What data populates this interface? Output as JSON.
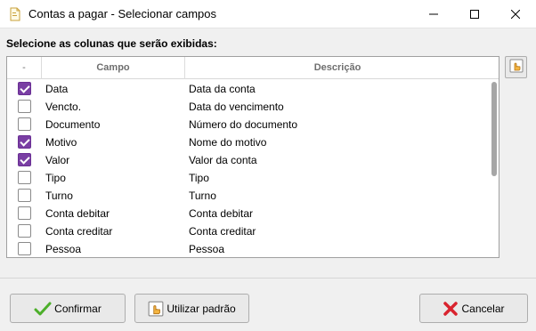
{
  "window": {
    "title": "Contas a pagar - Selecionar campos"
  },
  "section_label": "Selecione as colunas que serão exibidas:",
  "grid": {
    "headers": {
      "check": "-",
      "campo": "Campo",
      "descricao": "Descrição"
    },
    "rows": [
      {
        "checked": true,
        "campo": "Data",
        "descricao": "Data da conta"
      },
      {
        "checked": false,
        "campo": "Vencto.",
        "descricao": "Data do vencimento"
      },
      {
        "checked": false,
        "campo": "Documento",
        "descricao": "Número do documento"
      },
      {
        "checked": true,
        "campo": "Motivo",
        "descricao": "Nome do motivo"
      },
      {
        "checked": true,
        "campo": "Valor",
        "descricao": "Valor da conta"
      },
      {
        "checked": false,
        "campo": "Tipo",
        "descricao": "Tipo"
      },
      {
        "checked": false,
        "campo": "Turno",
        "descricao": "Turno"
      },
      {
        "checked": false,
        "campo": "Conta debitar",
        "descricao": "Conta debitar"
      },
      {
        "checked": false,
        "campo": "Conta creditar",
        "descricao": "Conta creditar"
      },
      {
        "checked": false,
        "campo": "Pessoa",
        "descricao": "Pessoa"
      }
    ]
  },
  "buttons": {
    "confirm": "Confirmar",
    "default": "Utilizar padrão",
    "cancel": "Cancelar"
  },
  "icons": {
    "title": "document-icon",
    "side": "hand-pointer-icon",
    "confirm": "checkmark-icon",
    "default": "hand-pointer-icon",
    "cancel": "x-icon"
  },
  "colors": {
    "checkbox_checked": "#7a3fa4",
    "confirm_icon": "#4caf2a",
    "cancel_icon": "#d9232e"
  }
}
